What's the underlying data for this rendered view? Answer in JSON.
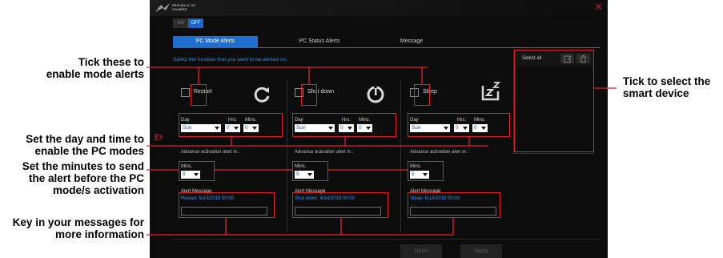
{
  "callouts": {
    "tick_mode": "Tick these to\nenable mode alerts",
    "set_day_time": "Set the day and time to\nenable the PC modes",
    "set_minutes": "Set the minutes to send\nthe alert before the PC\nmode/s activation",
    "key_in": "Key in your messages for\nmore information",
    "tick_device": "Tick to select the\nsmart device"
  },
  "app": {
    "brand_line1": "REPUBLIC OF",
    "brand_line2": "GAMERS",
    "close_icon": "close-icon",
    "toggle": {
      "on": "ON",
      "off": "OFF",
      "selected": "OFF"
    },
    "tabs": [
      {
        "label": "PC Mode Alerts",
        "active": true
      },
      {
        "label": "PC Status Alerts",
        "active": false
      },
      {
        "label": "Message",
        "active": false
      }
    ],
    "instruction": "Select the function that you want to be alerted on.",
    "columns": [
      {
        "mode": "Restart",
        "icon": "restart-icon",
        "day_label": "Day",
        "hrs_label": "Hrs.",
        "mins_label": "Mins.",
        "day": "Sun",
        "hrs": "0",
        "mins": "0",
        "advance_label": "Advance activation alert in :",
        "adv_mins_label": "Mins.",
        "adv_mins": "5",
        "alert_label": "Alert Message",
        "alert_text": "Restart: 6/14/2015 00:00"
      },
      {
        "mode": "Shut down",
        "icon": "power-icon",
        "day_label": "Day",
        "hrs_label": "Hrs.",
        "mins_label": "Mins.",
        "day": "Sun",
        "hrs": "0",
        "mins": "0",
        "advance_label": "Advance activation alert in :",
        "adv_mins_label": "Mins.",
        "adv_mins": "5",
        "alert_label": "Alert Message",
        "alert_text": "Shut down: 6/14/2015 00:00"
      },
      {
        "mode": "Sleep",
        "icon": "sleep-icon",
        "day_label": "Day",
        "hrs_label": "Hrs.",
        "mins_label": "Mins.",
        "day": "Sun",
        "hrs": "0",
        "mins": "0",
        "advance_label": "Advance activation alert in :",
        "adv_mins_label": "Mins.",
        "adv_mins": "5",
        "alert_label": "Alert Message",
        "alert_text": "Sleep: 6/14/2015 00:00"
      }
    ],
    "device_panel": {
      "select_all": "Select all",
      "edit_icon": "edit-icon",
      "delete_icon": "trash-icon"
    },
    "buttons": {
      "undo": "Undo",
      "apply": "Apply"
    },
    "colors": {
      "accent": "#1f6fd0",
      "highlight": "#e41f26",
      "link": "#2f8fe0"
    }
  }
}
